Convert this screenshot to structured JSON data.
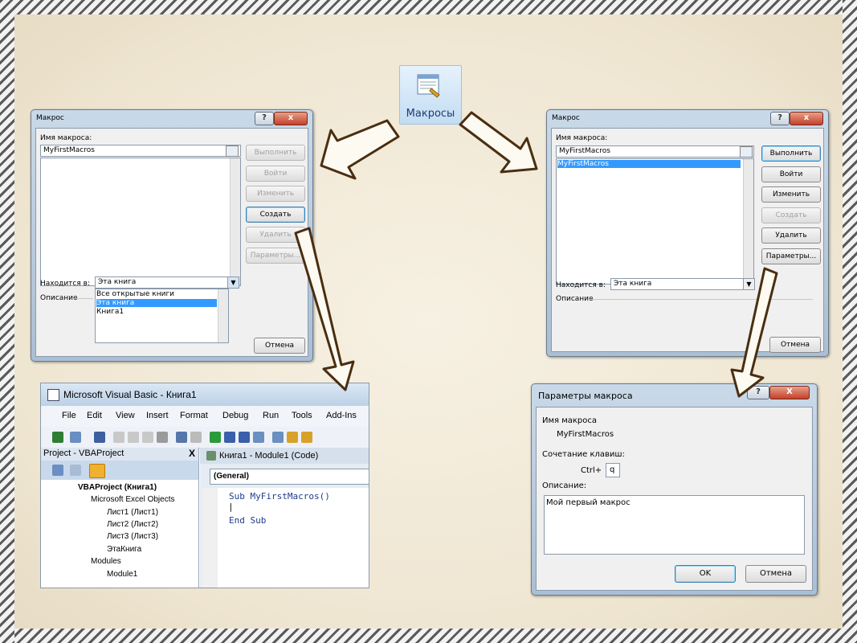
{
  "ribbon_button": {
    "label": "Макросы"
  },
  "macro_dialog_left": {
    "title": "Макрос",
    "name_label": "Имя макроса:",
    "name_value": "MyFirstMacros",
    "buttons": [
      "Выполнить",
      "Войти",
      "Изменить",
      "Создать",
      "Удалить",
      "Параметры..."
    ],
    "location_label": "Находится в:",
    "location_value": "Эта книга",
    "location_options": [
      "Все открытые книги",
      "Эта книга",
      "Книга1"
    ],
    "description_label": "Описание",
    "cancel": "Отмена",
    "help_glyph": "?",
    "close_glyph": "x"
  },
  "macro_dialog_right": {
    "title": "Макрос",
    "name_label": "Имя макроса:",
    "name_value": "MyFirstMacros",
    "list_items": [
      "MyFirstMacros"
    ],
    "buttons": [
      "Выполнить",
      "Войти",
      "Изменить",
      "Создать",
      "Удалить",
      "Параметры..."
    ],
    "location_label": "Находится в:",
    "location_value": "Эта книга",
    "description_label": "Описание",
    "cancel": "Отмена",
    "help_glyph": "?",
    "close_glyph": "x"
  },
  "vba_window": {
    "title": "Microsoft Visual Basic - Книга1",
    "menu": [
      "File",
      "Edit",
      "View",
      "Insert",
      "Format",
      "Debug",
      "Run",
      "Tools",
      "Add-Ins"
    ],
    "project_title": "Project - VBAProject",
    "project_close": "X",
    "tree": [
      "VBAProject (Книга1)",
      "Microsoft Excel Objects",
      "Лист1 (Лист1)",
      "Лист2 (Лист2)",
      "Лист3 (Лист3)",
      "ЭтаКнига",
      "Modules",
      "Module1"
    ],
    "code_title": "Книга1 - Module1 (Code)",
    "code_dropdown": "(General)",
    "code_lines": [
      "Sub MyFirstMacros()",
      "|",
      "End Sub"
    ]
  },
  "params_dialog": {
    "title": "Параметры макроса",
    "name_label": "Имя макроса",
    "name_value": "MyFirstMacros",
    "shortcut_label": "Сочетание клавиш:",
    "shortcut_prefix": "Ctrl+",
    "shortcut_key": "q",
    "description_label": "Описание:",
    "description_value": "Мой первый макрос",
    "ok": "OK",
    "cancel": "Отмена",
    "help_glyph": "?",
    "close_glyph": "X"
  }
}
